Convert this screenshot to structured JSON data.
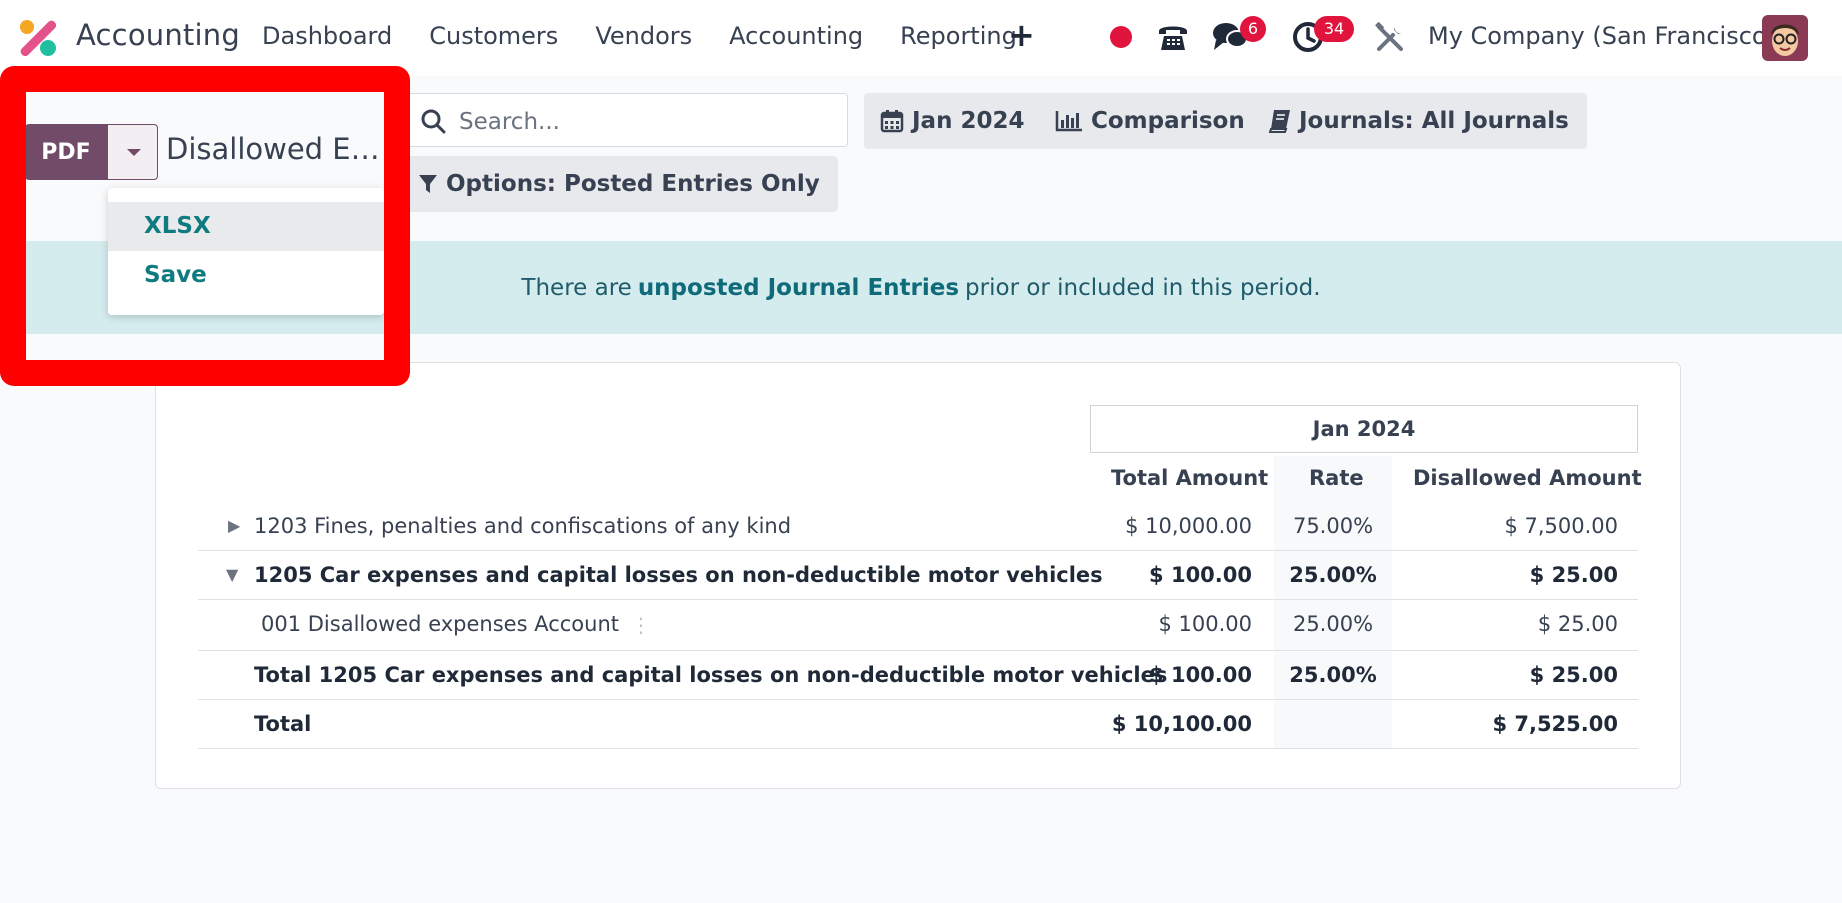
{
  "navbar": {
    "app_name": "Accounting",
    "menu": [
      "Dashboard",
      "Customers",
      "Vendors",
      "Accounting",
      "Reporting"
    ],
    "plus_label": "+",
    "chat_badge": "6",
    "activity_badge": "34",
    "company": "My Company (San Francisco)"
  },
  "export": {
    "pdf_label": "PDF",
    "report_title": "Disallowed E…",
    "dropdown": [
      "XLSX",
      "Save"
    ]
  },
  "search": {
    "placeholder": "Search..."
  },
  "filters": {
    "date": "Jan 2024",
    "comparison": "Comparison",
    "journals": "Journals: All Journals",
    "options": "Options: Posted Entries Only"
  },
  "notice": {
    "prefix": "There are",
    "link": "unposted Journal Entries",
    "suffix": "prior or included in this period."
  },
  "report": {
    "period": "Jan 2024",
    "columns": [
      "Total Amount",
      "Rate",
      "Disallowed Amount"
    ],
    "rows": [
      {
        "name": "1203 Fines, penalties and confiscations of any kind",
        "total": "$ 10,000.00",
        "rate": "75.00%",
        "disallowed": "$ 7,500.00"
      },
      {
        "name": "1205 Car expenses and capital losses on non-deductible motor vehicles",
        "total": "$ 100.00",
        "rate": "25.00%",
        "disallowed": "$ 25.00"
      },
      {
        "name": "001 Disallowed expenses Account",
        "total": "$ 100.00",
        "rate": "25.00%",
        "disallowed": "$ 25.00"
      },
      {
        "name": "Total 1205 Car expenses and capital losses on non-deductible motor vehicles",
        "total": "$ 100.00",
        "rate": "25.00%",
        "disallowed": "$ 25.00"
      },
      {
        "name": "Total",
        "total": "$ 10,100.00",
        "rate": "",
        "disallowed": "$ 7,525.00"
      }
    ]
  },
  "colors": {
    "brand": "#714b67",
    "badge": "#e0143c",
    "highlight": "#ff0000",
    "notice_bg": "#d4ecee",
    "link_teal": "#0f7a80"
  }
}
